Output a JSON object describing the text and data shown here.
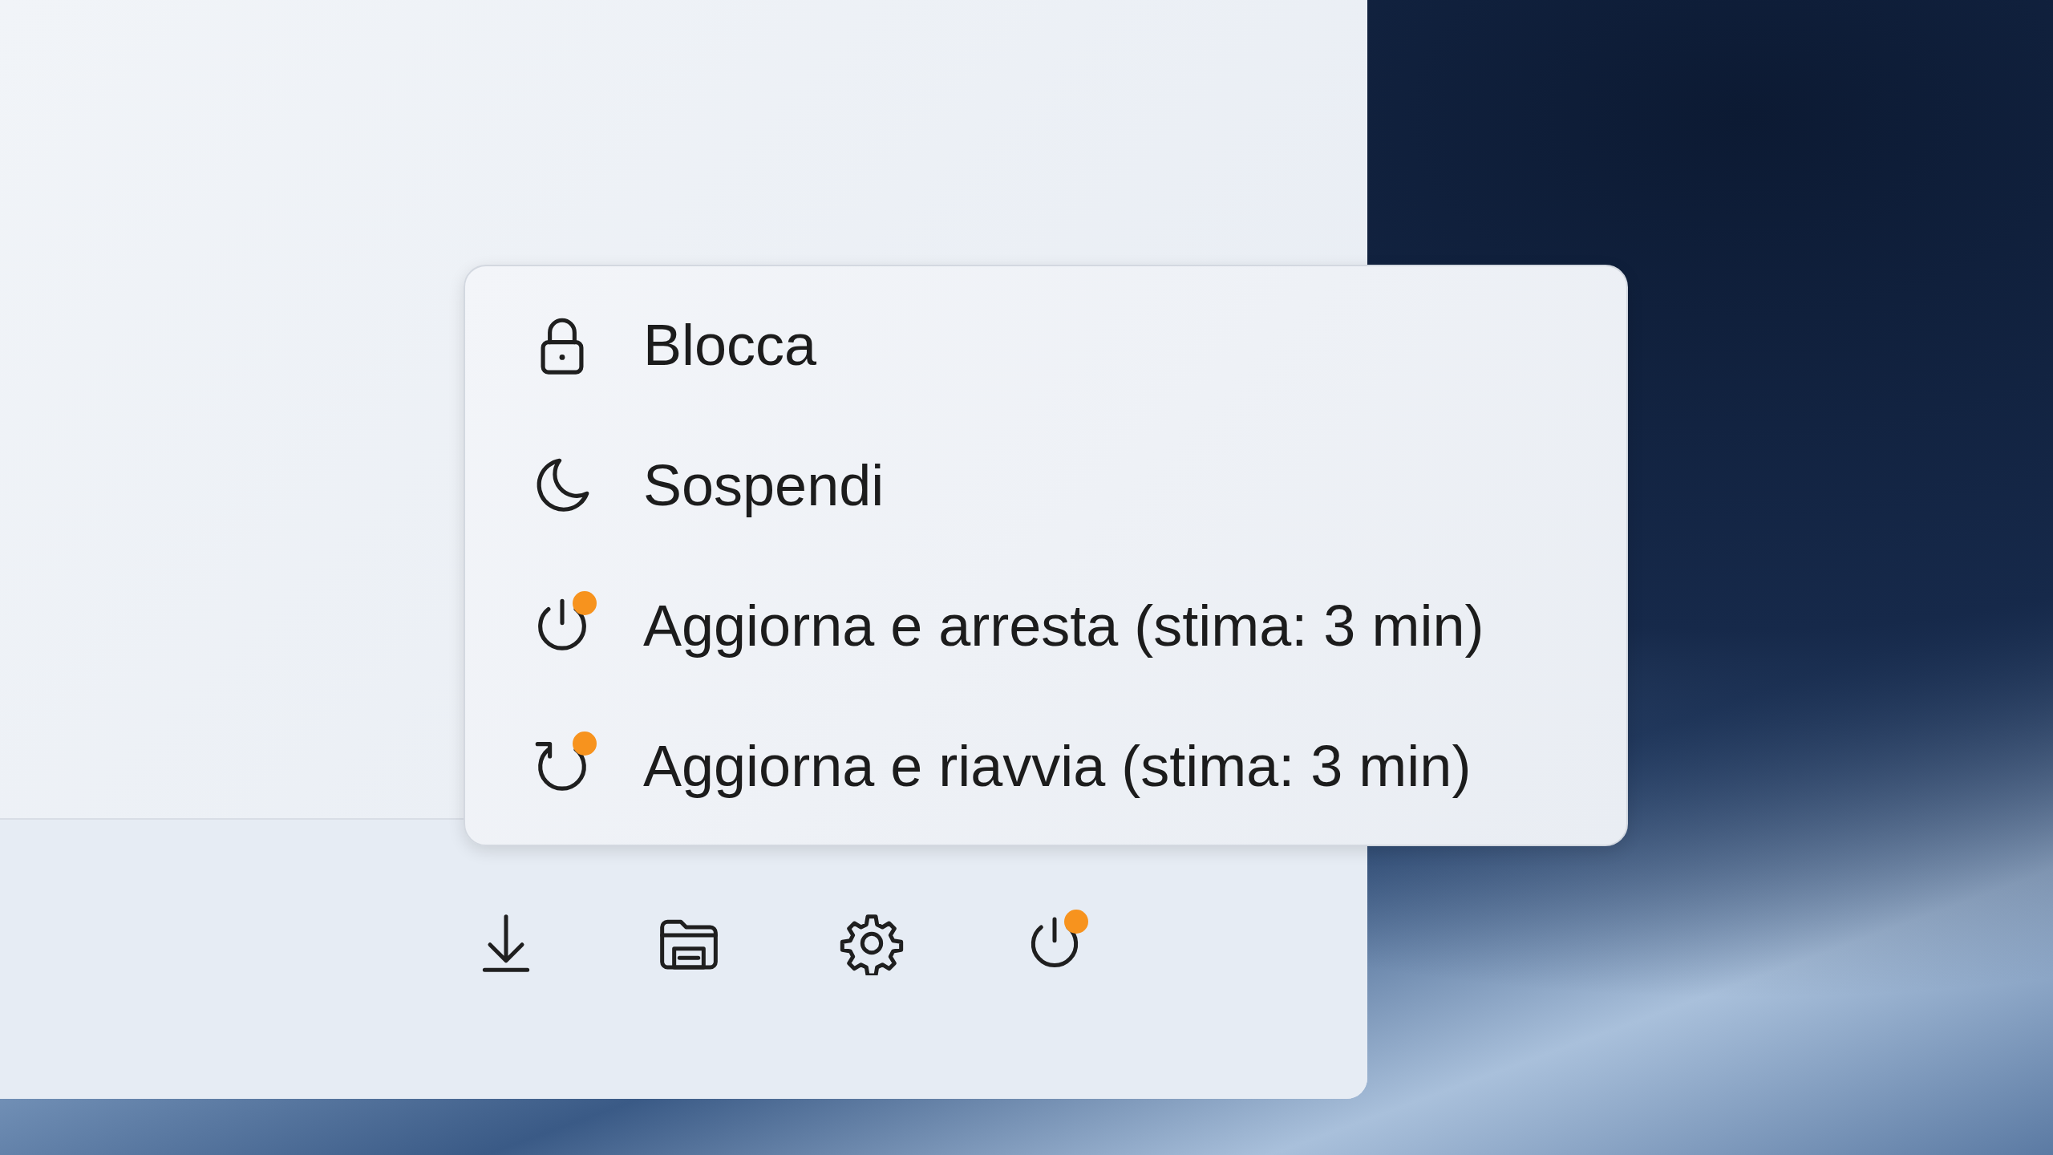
{
  "power_menu": {
    "items": [
      {
        "kind": "lock",
        "label": "Blocca",
        "badge": false
      },
      {
        "kind": "sleep",
        "label": "Sospendi",
        "badge": false
      },
      {
        "kind": "shutdown",
        "label": "Aggiorna e arresta (stima: 3 min)",
        "badge": true
      },
      {
        "kind": "restart",
        "label": "Aggiorna e riavvia (stima: 3 min)",
        "badge": true
      }
    ]
  },
  "footer": {
    "buttons": [
      {
        "kind": "download",
        "badge": false
      },
      {
        "kind": "explorer",
        "badge": false
      },
      {
        "kind": "settings",
        "badge": false
      },
      {
        "kind": "power",
        "badge": true
      }
    ]
  }
}
